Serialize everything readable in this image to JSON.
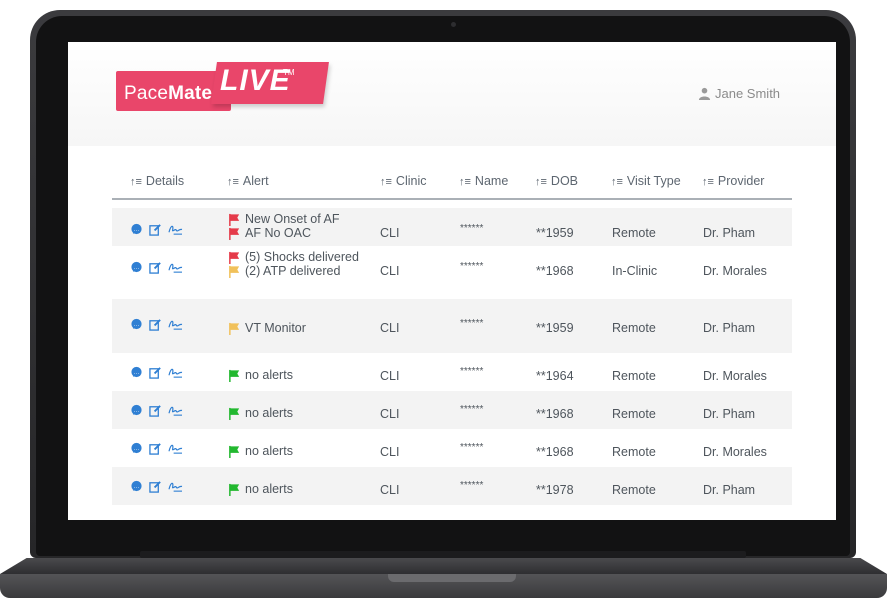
{
  "app": {
    "logo_pace": "Pace",
    "logo_mate": "Mate",
    "logo_live": "LIVE",
    "logo_tm": "TM",
    "user": "Jane Smith"
  },
  "columns": [
    "Details",
    "Alert",
    "Clinic",
    "Name",
    "DOB",
    "Visit Type",
    "Provider"
  ],
  "rows": [
    {
      "alerts": [
        {
          "text": "New Onset of AF",
          "color": "#e53b4a"
        },
        {
          "text": "AF No OAC",
          "color": "#e53b4a"
        }
      ],
      "clinic": "CLI",
      "name": "******",
      "dob": "**1959",
      "visit": "Remote",
      "provider": "Dr. Pham"
    },
    {
      "alerts": [
        {
          "text": "(5) Shocks delivered",
          "color": "#e53b4a"
        },
        {
          "text": "(2) ATP delivered",
          "color": "#f1c15a"
        }
      ],
      "clinic": "CLI",
      "name": "******",
      "dob": "**1968",
      "visit": "In-Clinic",
      "provider": "Dr. Morales"
    },
    {
      "alerts": [
        {
          "text": "VT Monitor",
          "color": "#f1c15a"
        }
      ],
      "clinic": "CLI",
      "name": "******",
      "dob": "**1959",
      "visit": "Remote",
      "provider": "Dr. Pham"
    },
    {
      "alerts": [
        {
          "text": "no alerts",
          "color": "#22b82f"
        }
      ],
      "clinic": "CLI",
      "name": "******",
      "dob": "**1964",
      "visit": "Remote",
      "provider": "Dr. Morales"
    },
    {
      "alerts": [
        {
          "text": "no alerts",
          "color": "#22b82f"
        }
      ],
      "clinic": "CLI",
      "name": "******",
      "dob": "**1968",
      "visit": "Remote",
      "provider": "Dr. Pham"
    },
    {
      "alerts": [
        {
          "text": "no alerts",
          "color": "#22b82f"
        }
      ],
      "clinic": "CLI",
      "name": "******",
      "dob": "**1968",
      "visit": "Remote",
      "provider": "Dr. Morales"
    },
    {
      "alerts": [
        {
          "text": "no alerts",
          "color": "#22b82f"
        }
      ],
      "clinic": "CLI",
      "name": "******",
      "dob": "**1978",
      "visit": "Remote",
      "provider": "Dr. Pham"
    }
  ],
  "icon_names": [
    "comment-icon",
    "edit-icon",
    "signature-icon"
  ],
  "colors": {
    "brand": "#e9466a",
    "icon_blue": "#2f7fd3"
  }
}
